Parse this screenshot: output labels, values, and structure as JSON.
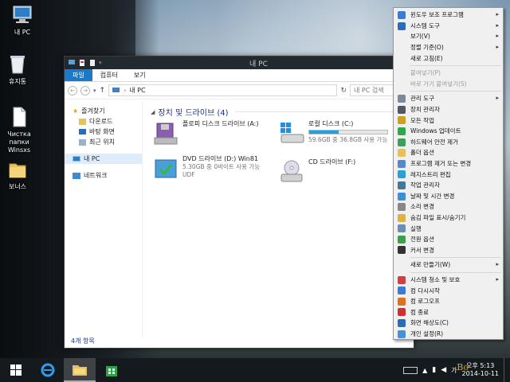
{
  "desktop": {
    "icons": [
      {
        "label": "내 PC",
        "icon": "computer-icon"
      },
      {
        "label": "휴지통",
        "icon": "recycle-bin-icon"
      },
      {
        "label": "Чистка папки Winsxs",
        "icon": "document-icon"
      },
      {
        "label": "보너스",
        "icon": "folder-icon"
      }
    ]
  },
  "explorer": {
    "title": "내 PC",
    "tabs": [
      "파일",
      "컴퓨터",
      "보기"
    ],
    "address": "내 PC",
    "search_placeholder": "내 PC 검색",
    "nav": {
      "favorites": "즐겨찾기",
      "favorites_items": [
        "다운로드",
        "바탕 화면",
        "최근 위치"
      ],
      "this_pc": "내 PC",
      "network": "네트워크"
    },
    "group_title": "장치 및 드라이브 (4)",
    "drives": [
      {
        "name": "플로피 디스크 드라이브 (A:)",
        "sub": "",
        "sub2": "",
        "icon": "floppy-drive-icon"
      },
      {
        "name": "로컬 디스크 (C:)",
        "sub": "59.6GB 중 36.8GB 사용 가능",
        "sub2": "",
        "icon": "local-disk-icon",
        "used_fraction": 0.38
      },
      {
        "name": "DVD 드라이브 (D:) Win81",
        "sub": "5.30GB 중 0바이트 사용 가능",
        "sub2": "UDF",
        "icon": "dvd-drive-icon"
      },
      {
        "name": "CD 드라이브 (F:)",
        "sub": "",
        "sub2": "",
        "icon": "cd-drive-icon"
      }
    ],
    "status": "4개 항목"
  },
  "context_menu": {
    "items": [
      {
        "label": "윈도우 보조 프로그램",
        "icon": "accessories-icon",
        "submenu": true,
        "disabled": false
      },
      {
        "label": "시스템 도구",
        "icon": "system-tools-icon",
        "submenu": true,
        "disabled": false
      },
      {
        "label": "보기(V)",
        "icon": "",
        "submenu": true,
        "disabled": false
      },
      {
        "label": "정렬 기준(O)",
        "icon": "",
        "submenu": true,
        "disabled": false
      },
      {
        "label": "새로 고침(E)",
        "icon": "",
        "submenu": false,
        "disabled": false
      },
      {
        "sep": true
      },
      {
        "label": "붙여넣기(P)",
        "icon": "",
        "submenu": false,
        "disabled": true
      },
      {
        "label": "바로 가기 붙여넣기(S)",
        "icon": "",
        "submenu": false,
        "disabled": true
      },
      {
        "sep": true
      },
      {
        "label": "관리 도구",
        "icon": "admin-tools-icon",
        "submenu": true,
        "disabled": false
      },
      {
        "label": "장치 관리자",
        "icon": "device-manager-icon",
        "submenu": false,
        "disabled": false
      },
      {
        "label": "모든 작업",
        "icon": "all-tasks-icon",
        "submenu": false,
        "disabled": false
      },
      {
        "label": "Windows 업데이트",
        "icon": "windows-update-icon",
        "submenu": false,
        "disabled": false
      },
      {
        "label": "하드웨어 안전 제거",
        "icon": "safely-remove-icon",
        "submenu": false,
        "disabled": false
      },
      {
        "label": "폴더 옵션",
        "icon": "folder-options-icon",
        "submenu": false,
        "disabled": false
      },
      {
        "label": "프로그램 제거 또는 변경",
        "icon": "programs-icon",
        "submenu": false,
        "disabled": false
      },
      {
        "label": "레지스트리 편집",
        "icon": "registry-icon",
        "submenu": false,
        "disabled": false
      },
      {
        "label": "작업 관리자",
        "icon": "task-manager-icon",
        "submenu": false,
        "disabled": false
      },
      {
        "label": "날짜 및 시간 변경",
        "icon": "date-time-icon",
        "submenu": false,
        "disabled": false
      },
      {
        "label": "소리 변경",
        "icon": "sound-icon",
        "submenu": false,
        "disabled": false
      },
      {
        "label": "숨김 파일 표시/숨기기",
        "icon": "hidden-files-icon",
        "submenu": false,
        "disabled": false
      },
      {
        "label": "실행",
        "icon": "run-icon",
        "submenu": false,
        "disabled": false
      },
      {
        "label": "전원 옵션",
        "icon": "power-options-icon",
        "submenu": false,
        "disabled": false
      },
      {
        "label": "커서 변경",
        "icon": "cursor-icon",
        "submenu": false,
        "disabled": false
      },
      {
        "sep": true
      },
      {
        "label": "새로 만들기(W)",
        "icon": "",
        "submenu": true,
        "disabled": false
      },
      {
        "sep": true
      },
      {
        "label": "시스템 청소 및 보호",
        "icon": "shield-icon",
        "submenu": true,
        "disabled": false
      },
      {
        "label": "컴 다시시작",
        "icon": "restart-icon",
        "submenu": false,
        "disabled": false
      },
      {
        "label": "컴 로그오프",
        "icon": "logoff-icon",
        "submenu": false,
        "disabled": false
      },
      {
        "label": "컴 종료",
        "icon": "shutdown-icon",
        "submenu": false,
        "disabled": false
      },
      {
        "label": "화면 해상도(C)",
        "icon": "resolution-icon",
        "submenu": false,
        "disabled": false
      },
      {
        "label": "개인 설정(R)",
        "icon": "personalize-icon",
        "submenu": false,
        "disabled": false
      }
    ]
  },
  "taskbar": {
    "apps": [
      "start-icon",
      "internet-explorer-icon",
      "file-explorer-icon",
      "store-icon"
    ],
    "time": "오후 5:13",
    "date": "2014-10-11"
  },
  "watermark": "Bo"
}
